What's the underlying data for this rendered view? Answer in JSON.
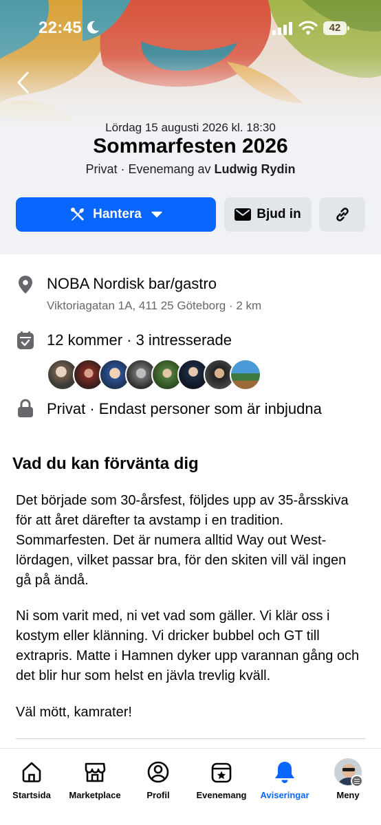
{
  "status_bar": {
    "time": "22:45",
    "battery": "42"
  },
  "event": {
    "date": "Lördag 15 augusti 2026 kl. 18:30",
    "title": "Sommarfesten 2026",
    "privacy_prefix": "Privat · Evenemang av ",
    "host": "Ludwig Rydin"
  },
  "actions": {
    "manage_label": "Hantera",
    "invite_label": "Bjud in"
  },
  "details": {
    "location_name": "NOBA Nordisk bar/gastro",
    "location_address": "Viktoriagatan 1A, 411 25 Göteborg · 2 km",
    "attendance": "12 kommer · 3 intresserade",
    "privacy": "Privat · Endast personer som är inbjudna"
  },
  "description": {
    "title": "Vad du kan förvänta dig",
    "paragraphs": [
      "Det började som 30-årsfest, följdes upp av 35-årsskiva för att året därefter ta avstamp i en tradition. Sommarfesten. Det är numera alltid Way out West-lördagen, vilket passar bra, för den skiten vill väl ingen gå på ändå.",
      "Ni som varit med, ni vet vad som gäller. Vi klär oss i kostym eller klänning. Vi dricker bubbel och GT till extrapris. Matte i Hamnen dyker upp varannan gång och det blir hur som helst en jävla trevlig kväll.",
      "Väl mött, kamrater!"
    ]
  },
  "tabs": [
    {
      "label": "Startsida",
      "icon": "home-icon"
    },
    {
      "label": "Marketplace",
      "icon": "marketplace-icon"
    },
    {
      "label": "Profil",
      "icon": "profile-icon"
    },
    {
      "label": "Evenemang",
      "icon": "events-icon"
    },
    {
      "label": "Aviseringar",
      "icon": "bell-icon",
      "active": true
    },
    {
      "label": "Meny",
      "icon": "menu-avatar"
    }
  ],
  "colors": {
    "accent": "#0866ff",
    "secondary_button": "#e2e5e9",
    "muted_text": "#65676b"
  }
}
